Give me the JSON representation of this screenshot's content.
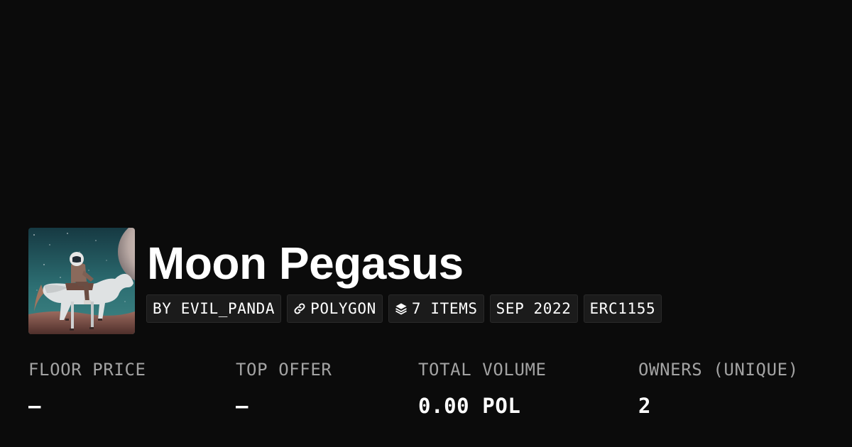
{
  "collection": {
    "title": "Moon Pegasus",
    "image_alt": "Astronaut riding a white horse under a planet-filled starry sky"
  },
  "badges": [
    {
      "label": "BY EVIL_PANDA",
      "icon": null
    },
    {
      "label": "POLYGON",
      "icon": "link-icon"
    },
    {
      "label": "7 ITEMS",
      "icon": "layers-icon"
    },
    {
      "label": "SEP 2022",
      "icon": null
    },
    {
      "label": "ERC1155",
      "icon": null
    }
  ],
  "stats": [
    {
      "label": "FLOOR PRICE",
      "value": "–"
    },
    {
      "label": "TOP OFFER",
      "value": "–"
    },
    {
      "label": "TOTAL VOLUME",
      "value": "0.00 POL"
    },
    {
      "label": "OWNERS (UNIQUE)",
      "value": "2"
    }
  ],
  "colors": {
    "background": "#0b0b0b",
    "badge_background": "#1b1b1b",
    "label_gray": "#a3a3a3",
    "text": "#ffffff"
  }
}
